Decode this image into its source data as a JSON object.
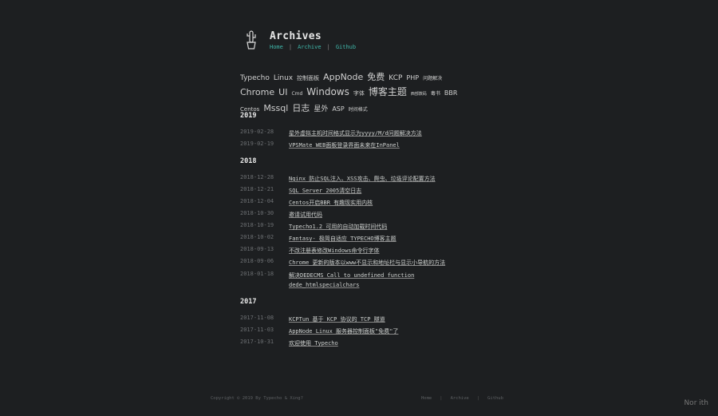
{
  "site": {
    "title": "Archives",
    "nav": [
      "Home",
      "Archive",
      "Github"
    ]
  },
  "tags": [
    {
      "label": "Typecho",
      "size": 9
    },
    {
      "label": "Linux",
      "size": 9
    },
    {
      "label": "控制面板",
      "size": 7
    },
    {
      "label": "AppNode",
      "size": 11
    },
    {
      "label": "免费",
      "size": 11
    },
    {
      "label": "KCP",
      "size": 9
    },
    {
      "label": "PHP",
      "size": 8
    },
    {
      "label": "问题解决",
      "size": 6
    },
    {
      "label": "Chrome",
      "size": 11
    },
    {
      "label": "UI",
      "size": 11
    },
    {
      "label": "Cmd",
      "size": 6
    },
    {
      "label": "Windows",
      "size": 12
    },
    {
      "label": "字体",
      "size": 7
    },
    {
      "label": "博客主题",
      "size": 12
    },
    {
      "label": "西部数码",
      "size": 5
    },
    {
      "label": "毒书",
      "size": 6
    },
    {
      "label": "BBR",
      "size": 8
    },
    {
      "label": "Centos",
      "size": 7
    },
    {
      "label": "Mssql",
      "size": 11
    },
    {
      "label": "日志",
      "size": 11
    },
    {
      "label": "星外",
      "size": 9
    },
    {
      "label": "ASP",
      "size": 8
    },
    {
      "label": "时间格式",
      "size": 6
    }
  ],
  "archives": [
    {
      "year": "2019",
      "posts": [
        {
          "date": "2019-02-28",
          "title": "星外虚拟主机时间格式显示为yyyy/M/d问题解决方法"
        },
        {
          "date": "2019-02-19",
          "title": "VPSMate WEB面板登录界面未来在InPanel"
        }
      ]
    },
    {
      "year": "2018",
      "posts": [
        {
          "date": "2018-12-28",
          "title": "Nginx 防止SQL注入、XSS攻击、爬虫、垃圾评论配置方法"
        },
        {
          "date": "2018-12-21",
          "title": "SQL Server 2005清空日志"
        },
        {
          "date": "2018-12-04",
          "title": "Centos开启BBR 有趣现实用内核"
        },
        {
          "date": "2018-10-30",
          "title": "邀请试用代码"
        },
        {
          "date": "2018-10-19",
          "title": "Typecho1.2 可用的自动加载时间代码"
        },
        {
          "date": "2018-10-02",
          "title": "Fantasy- 极简自适应 TYPECHO博客主题"
        },
        {
          "date": "2018-09-13",
          "title": "不改注册表修改Windows命令行字体"
        },
        {
          "date": "2018-09-06",
          "title": "Chrome 更新的版本以www不显示和地址栏与显示小导航的方法"
        },
        {
          "date": "2018-01-18",
          "title": "解决DEDECMS Call to undefined function dede_htmlspecialchars"
        }
      ]
    },
    {
      "year": "2017",
      "posts": [
        {
          "date": "2017-11-08",
          "title": "KCPTun 基于 KCP 协议的 TCP 隧道"
        },
        {
          "date": "2017-11-03",
          "title": "AppNode Linux 服务器控制面板\"免费\"了"
        },
        {
          "date": "2017-10-31",
          "title": "欢迎使用 Typecho"
        }
      ]
    }
  ],
  "footer": {
    "copyright": "Copyright © 2019 By Typecho & Xing?",
    "nav": [
      "Home",
      "Archive",
      "Github"
    ]
  },
  "corner_text": "Nor ith",
  "colors": {
    "background": "#1d1f21",
    "accent": "#3fb5a8",
    "text": "#c5c8c6"
  }
}
